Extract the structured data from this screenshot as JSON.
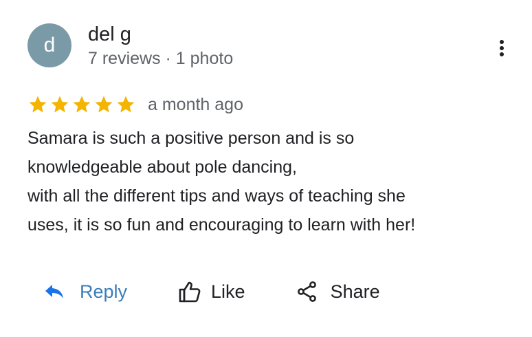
{
  "author": {
    "avatar_letter": "d",
    "avatar_color": "#7b9aa8",
    "name": "del g",
    "meta": "7 reviews · 1 photo"
  },
  "menu": {
    "icon": "more-vert-icon"
  },
  "review": {
    "rating": 5,
    "max_rating": 5,
    "star_color": "#f4b400",
    "date": "a month ago",
    "text_lines": [
      "Samara is such a positive person and is so",
      "knowledgeable about pole dancing,",
      "with all the different tips and ways of teaching she",
      "uses, it is so fun and encouraging to learn with her!"
    ]
  },
  "actions": {
    "reply_label": "Reply",
    "reply_icon": "reply-arrow-icon",
    "like_label": "Like",
    "like_icon": "thumbs-up-icon",
    "share_label": "Share",
    "share_icon": "share-icon"
  }
}
